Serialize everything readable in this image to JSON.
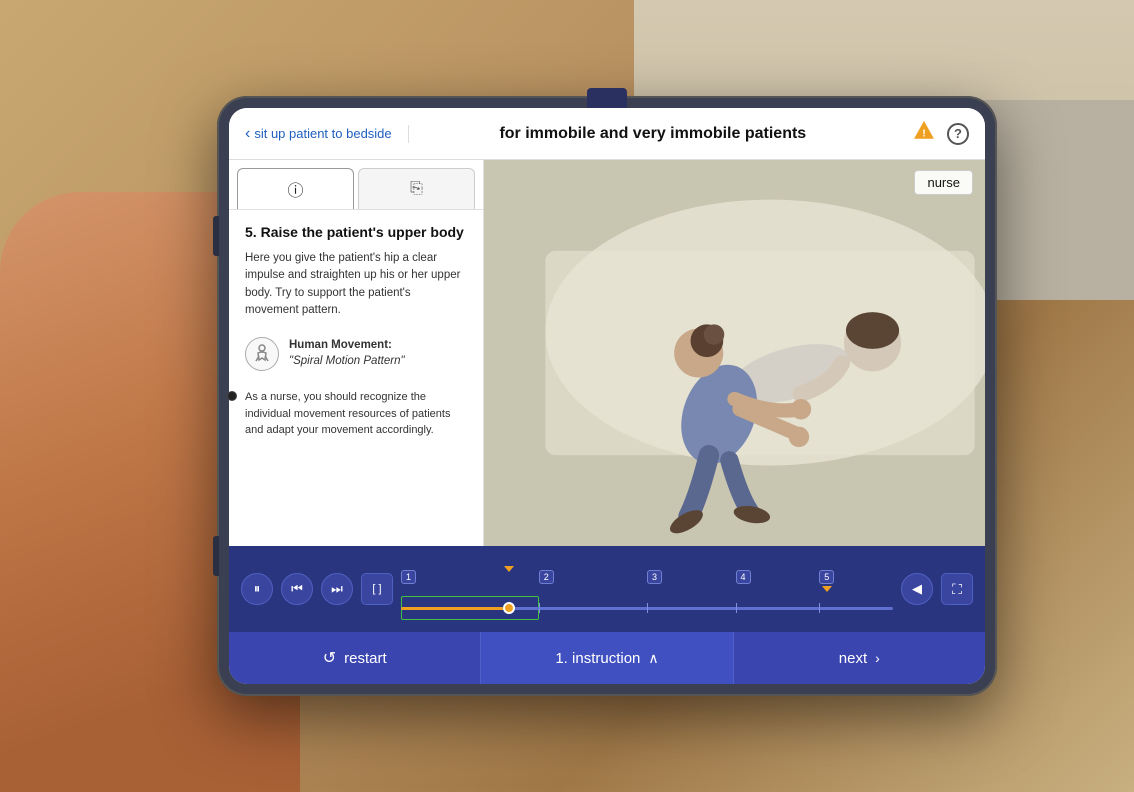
{
  "environment": {
    "background_color": "#b8a080"
  },
  "header": {
    "back_label": "sit up patient to bedside",
    "title": "for immobile and very immobile patients",
    "warning_icon": "⚠",
    "help_icon": "?"
  },
  "tabs": [
    {
      "icon": "ℹ",
      "label": "info",
      "active": true
    },
    {
      "icon": "⎘",
      "label": "steps",
      "active": false
    }
  ],
  "left_panel": {
    "step_number": "5.",
    "step_title": "Raise the patient's upper body",
    "step_description": "Here you give the patient's hip a clear impulse and straighten up his or her upper body. Try to support the patient's movement pattern.",
    "human_movement_label": "Human Movement:",
    "human_movement_subtitle": "\"Spiral Motion Pattern\"",
    "movement_note": "As a nurse, you should recognize the individual movement resources of patients and adapt your movement accordingly."
  },
  "scene": {
    "nurse_label": "nurse",
    "background_color": "#c8c5b0"
  },
  "controls": {
    "pause_icon": "⏸",
    "skip_back_icon": "⏮",
    "skip_forward_icon": "⏭",
    "bracket_icon": "[ ]",
    "volume_icon": "◀",
    "fullscreen_icon": "⛶",
    "timeline_progress_percent": 22,
    "markers": [
      {
        "label": "1",
        "position": 0
      },
      {
        "label": "2",
        "position": 28
      },
      {
        "label": "3",
        "position": 50
      },
      {
        "label": "4",
        "position": 68
      },
      {
        "label": "5",
        "position": 85
      }
    ]
  },
  "bottom_bar": {
    "restart_label": "restart",
    "instruction_label": "1. instruction",
    "next_label": "next"
  }
}
